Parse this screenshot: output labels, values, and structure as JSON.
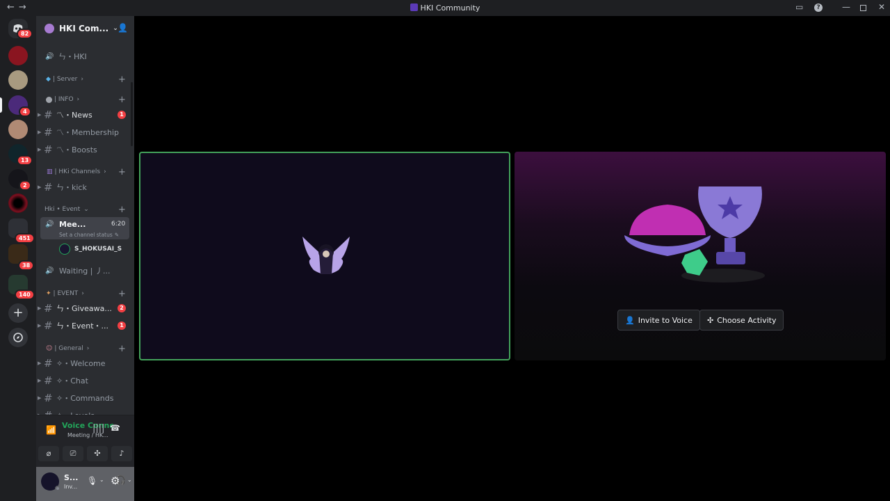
{
  "window": {
    "title": "HKI Community",
    "nav_back": "←",
    "nav_forward": "→"
  },
  "guilds": {
    "badges": [
      "82",
      "4",
      "13",
      "2",
      "451",
      "38",
      "140"
    ]
  },
  "server": {
    "name": "HKI Com...",
    "channels": {
      "hki_voice": "ㄣ・HKI",
      "cat_server": "| Server",
      "cat_info": "| INFO",
      "news": "〽・News",
      "news_badge": "1",
      "membership": "〽・Membership",
      "boosts": "〽・Boosts",
      "cat_hki_channels": "| HKi Channels",
      "kick": "ㄣ・kick",
      "cat_event": "Hki • Event",
      "meeting": "Mee...",
      "meeting_time": "6:20",
      "set_status": "Set a channel status",
      "member": "S_HOKUSAI_S",
      "waiting": "Waiting | 丿...",
      "cat_event2": "| EVENT",
      "giveaway": "ㄣ・Giveawa...",
      "giveaway_badge": "2",
      "event": "ㄣ・Event・...",
      "event_badge": "1",
      "cat_general": "| General",
      "welcome": "✧・Welcome",
      "chat": "✧・Chat",
      "commands": "✧・Commands",
      "levels": "✧・Levels"
    }
  },
  "voice_panel": {
    "status": "Voice Connecte",
    "channel": "Meeting / HK..."
  },
  "user_panel": {
    "name": "S...",
    "status": "Inv..."
  },
  "stage": {
    "invite_label": "Invite to Voice",
    "activity_label": "Choose Activity"
  },
  "colors": {
    "accent_green": "#43a25a",
    "badge_red": "#f23f43",
    "sidebar_bg": "#2b2d31",
    "guild_bg": "#1e1f22"
  }
}
